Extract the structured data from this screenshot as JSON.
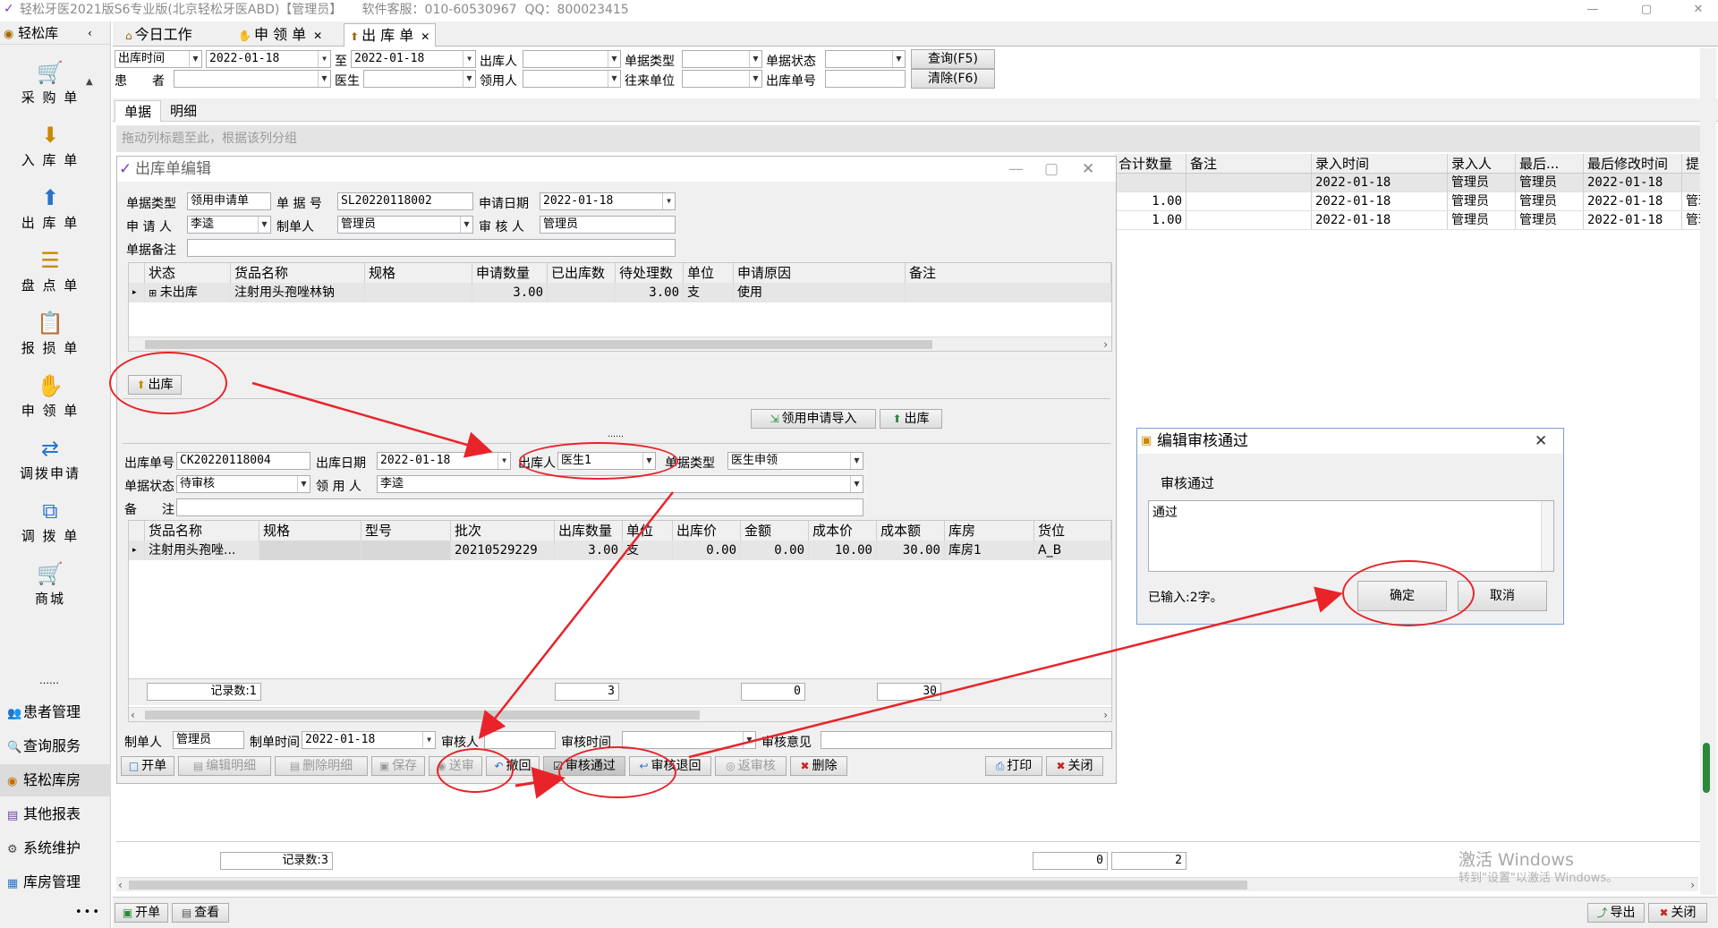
{
  "window": {
    "title": "轻松牙医2021版S6专业版(北京轻松牙医ABD)【管理员】     软件客服：010-60530967  QQ：800023415"
  },
  "sidebar": {
    "header": "轻松库",
    "items": [
      {
        "label": "采 购 单",
        "icon": "cart-icon"
      },
      {
        "label": "入 库 单",
        "icon": "inbox-in-icon"
      },
      {
        "label": "出 库 单",
        "icon": "inbox-out-icon"
      },
      {
        "label": "盘 点 单",
        "icon": "stack-icon"
      },
      {
        "label": "报 损 单",
        "icon": "clipboard-icon"
      },
      {
        "label": "申 领 单",
        "icon": "hand-icon"
      },
      {
        "label": "调拨申请",
        "icon": "transfer-request-icon"
      },
      {
        "label": "调 拨 单",
        "icon": "transfer-icon"
      },
      {
        "label": "商城",
        "icon": "shop-cart-icon"
      }
    ],
    "dots": "……",
    "modules": [
      {
        "label": "患者管理",
        "icon": "patients-icon"
      },
      {
        "label": "查询服务",
        "icon": "query-icon"
      },
      {
        "label": "轻松库房",
        "icon": "warehouse-icon",
        "active": true
      },
      {
        "label": "其他报表",
        "icon": "report-icon"
      },
      {
        "label": "系统维护",
        "icon": "gears-icon"
      },
      {
        "label": "库房管理",
        "icon": "store-icon"
      }
    ],
    "more": "•••"
  },
  "tabs": [
    {
      "label": "今日工作",
      "closable": false
    },
    {
      "label": "申 领 单",
      "closable": true
    },
    {
      "label": "出 库 单",
      "closable": true,
      "active": true
    }
  ],
  "filters": {
    "row1": {
      "date_field": "出库时间",
      "date_from": "2022-01-18",
      "to": "至",
      "date_to": "2022-01-18",
      "out_person_label": "出库人",
      "doc_type_label": "单据类型",
      "doc_status_label": "单据状态",
      "query_btn": "查询(F5)"
    },
    "row2": {
      "patient_label": "患　　者",
      "doctor_label": "医生",
      "receiver_label": "领用人",
      "partner_label": "往来单位",
      "out_no_label": "出库单号",
      "clear_btn": "清除(F6)"
    }
  },
  "subtabs": [
    "单据",
    "明细"
  ],
  "group_hint": "拖动列标题至此，根据该列分组",
  "right_grid": {
    "columns": [
      "合计数量",
      "备注",
      "录入时间",
      "录入人",
      "最后...",
      "最后修改时间",
      "提交"
    ],
    "rows": [
      [
        "",
        "",
        "2022-01-18",
        "管理员",
        "管理员",
        "2022-01-18",
        ""
      ],
      [
        "1.00",
        "",
        "2022-01-18",
        "管理员",
        "管理员",
        "2022-01-18",
        "管理"
      ],
      [
        "1.00",
        "",
        "2022-01-18",
        "管理员",
        "管理员",
        "2022-01-18",
        "管理"
      ]
    ]
  },
  "main_footer": {
    "record_count": "记录数:3",
    "sum1": "0",
    "sum2": "2"
  },
  "watermark": {
    "line1": "激活 Windows",
    "line2": "转到\"设置\"以激活 Windows。"
  },
  "bottom_bar": {
    "new_btn": "开单",
    "view_btn": "查看",
    "export_btn": "导出",
    "close_btn": "关闭"
  },
  "dialog": {
    "title": "出库单编辑",
    "req": {
      "doc_type_label": "单据类型",
      "doc_type": "领用申请单",
      "doc_no_label": "单 据 号",
      "doc_no": "SL20220118002",
      "apply_date_label": "申请日期",
      "apply_date": "2022-01-18",
      "applicant_label": "申 请 人",
      "applicant": "李逵",
      "maker_label": "制单人",
      "maker": "管理员",
      "auditor_label": "审 核 人",
      "auditor": "管理员",
      "remark_label": "单据备注",
      "grid_columns": [
        "状态",
        "货品名称",
        "规格",
        "申请数量",
        "已出库数",
        "待处理数",
        "单位",
        "申请原因",
        "备注"
      ],
      "grid_row": [
        "未出库",
        "注射用头孢唑林钠",
        "",
        "3.00",
        "",
        "3.00",
        "支",
        "使用",
        ""
      ],
      "out_btn": "出库"
    },
    "import_btn": "领用申请导入",
    "out_btn2": "出库",
    "splitter": "……",
    "out": {
      "out_no_label": "出库单号",
      "out_no": "CK20220118004",
      "out_date_label": "出库日期",
      "out_date": "2022-01-18",
      "out_person_label": "出库人",
      "out_person": "医生1",
      "doc_type_label": "单据类型",
      "doc_type": "医生申领",
      "status_label": "单据状态",
      "status": "待审核",
      "receiver_label": "领 用 人",
      "receiver": "李逵",
      "remark_label": "备　　注",
      "grid_columns": [
        "货品名称",
        "规格",
        "型号",
        "批次",
        "出库数量",
        "单位",
        "出库价",
        "金额",
        "成本价",
        "成本额",
        "库房",
        "货位"
      ],
      "grid_row": [
        "注射用头孢唑...",
        "",
        "",
        "20210529229",
        "3.00",
        "支",
        "0.00",
        "0.00",
        "10.00",
        "30.00",
        "库房1",
        "A_B"
      ],
      "record_count": "记录数:1",
      "sum_qty": "3",
      "sum_amount": "0",
      "sum_cost": "30",
      "maker_label": "制单人",
      "maker": "管理员",
      "make_time_label": "制单时间",
      "make_time": "2022-01-18",
      "auditor_label": "审核人",
      "audit_time_label": "审核时间",
      "audit_opinion_label": "审核意见"
    },
    "actions": {
      "new": "开单",
      "edit": "编辑明细",
      "delete_detail": "删除明细",
      "save": "保存",
      "submit": "送审",
      "revoke": "撤回",
      "approve": "审核通过",
      "reject": "审核退回",
      "unapprove": "返审核",
      "delete": "删除",
      "print": "打印",
      "close": "关闭"
    }
  },
  "popup": {
    "title": "编辑审核通过",
    "label": "审核通过",
    "text": "通过",
    "count": "已输入:2字。",
    "ok": "确定",
    "cancel": "取消"
  },
  "colors": {
    "annotation": "#e8242a",
    "panel": "#f0f0f0",
    "selected_row": "#e6e6e6"
  }
}
